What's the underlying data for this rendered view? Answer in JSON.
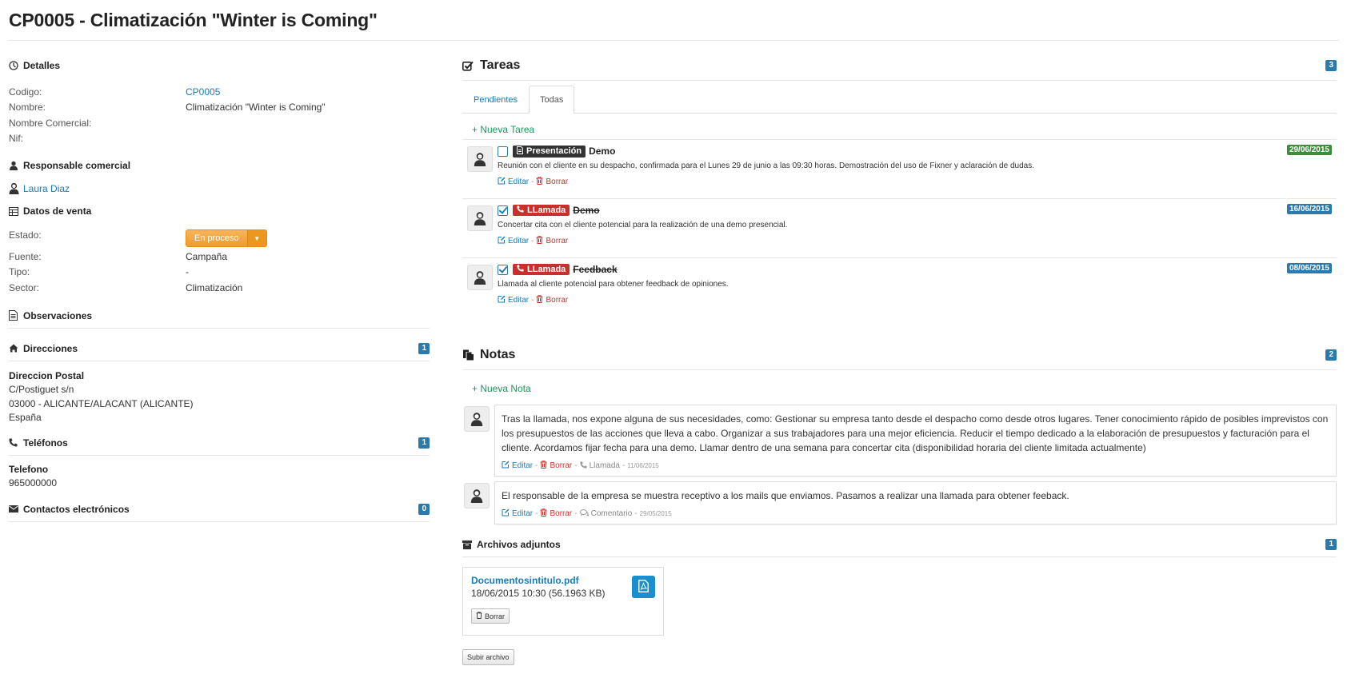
{
  "title": "CP0005 - Climatización \"Winter is Coming\"",
  "detalles": {
    "heading": "Detalles",
    "fields": [
      {
        "label": "Codigo:",
        "value": "CP0005"
      },
      {
        "label": "Nombre:",
        "value": "Climatización \"Winter is Coming\""
      },
      {
        "label": "Nombre Comercial:",
        "value": ""
      },
      {
        "label": "Nif:",
        "value": ""
      }
    ]
  },
  "responsable": {
    "heading": "Responsable comercial",
    "name": "Laura Diaz"
  },
  "ventas": {
    "heading": "Datos de venta",
    "estado_label": "Estado:",
    "estado_value": "En proceso",
    "fields": [
      {
        "label": "Fuente:",
        "value": "Campaña"
      },
      {
        "label": "Tipo:",
        "value": "-"
      },
      {
        "label": "Sector:",
        "value": "Climatización"
      }
    ]
  },
  "observaciones": {
    "heading": "Observaciones"
  },
  "direcciones": {
    "heading": "Direcciones",
    "count": "1",
    "title": "Direccion Postal",
    "lines": [
      "C/Postiguet s/n",
      "03000 - ALICANTE/ALACANT (ALICANTE)",
      "España"
    ]
  },
  "telefonos": {
    "heading": "Teléfonos",
    "count": "1",
    "title": "Telefono",
    "number": "965000000"
  },
  "contactos": {
    "heading": "Contactos electrónicos",
    "count": "0"
  },
  "tareas": {
    "heading": "Tareas",
    "count": "3",
    "tabs": [
      "Pendientes",
      "Todas"
    ],
    "new_label": "+ Nueva Tarea",
    "edit_label": "Editar",
    "delete_label": "Borrar",
    "items": [
      {
        "type": "Presentación",
        "title": "Demo",
        "date": "29/06/2015",
        "desc": "Reunión con el cliente en su despacho, confirmada para el Lunes 29 de junio a las 09:30 horas. Demostración del uso de Fixner y aclaración de dudas."
      },
      {
        "type": "LLamada",
        "title": "Demo",
        "date": "16/06/2015",
        "desc": "Concertar cita con el cliente potencial para la realización de una demo presencial."
      },
      {
        "type": "LLamada",
        "title": "Feedback",
        "date": "08/06/2015",
        "desc": "Llamada al cliente potencial para obtener feedback de opiniones."
      }
    ]
  },
  "notas": {
    "heading": "Notas",
    "count": "2",
    "new_label": "+ Nueva Nota",
    "items": [
      {
        "text": "Tras la llamada, nos expone alguna de sus necesidades, como: Gestionar su empresa tanto desde el despacho como desde otros lugares. Tener conocimiento rápido de posibles imprevistos con los presupuestos de las acciones que lleva a cabo. Organizar a sus trabajadores para una mejor eficiencia. Reducir el tiempo dedicado a la elaboración de presupuestos y facturación para el cliente. Acordamos fijar fecha para una demo. Llamar dentro de una semana para concertar cita (disponibilidad horaria del cliente limitada actualmente)",
        "kind": "Llamada",
        "date": "11/06/2015"
      },
      {
        "text": "El responsable de la empresa se muestra receptivo a los mails que enviamos. Pasamos a realizar una llamada para obtener feeback.",
        "kind": "Comentario",
        "date": "29/05/2015"
      }
    ]
  },
  "archivos": {
    "heading": "Archivos adjuntos",
    "count": "1",
    "file_name": "Documentosintitulo.pdf",
    "file_meta": "18/06/2015 10:30 (56.1963 KB)",
    "delete_label": "Borrar",
    "upload_label": "Subir archivo"
  }
}
